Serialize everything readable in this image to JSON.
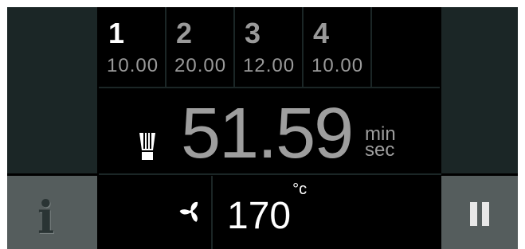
{
  "steps": [
    {
      "number": "1",
      "value": "10.00",
      "active": true
    },
    {
      "number": "2",
      "value": "20.00",
      "active": false
    },
    {
      "number": "3",
      "value": "12.00",
      "active": false
    },
    {
      "number": "4",
      "value": "10.00",
      "active": false
    }
  ],
  "timer": {
    "value": "51.59",
    "unit_top": "min",
    "unit_bottom": "sec"
  },
  "temperature": {
    "value": "170",
    "unit": "°c"
  },
  "icons": {
    "mode": "grill-icon",
    "fan": "fan-icon",
    "info": "info-icon",
    "pause": "pause-icon"
  },
  "colors": {
    "background": "#000000",
    "side_panel": "#1b2626",
    "button_panel": "#555d5d",
    "active_text": "#ffffff",
    "inactive_text": "#9a9a9a"
  }
}
